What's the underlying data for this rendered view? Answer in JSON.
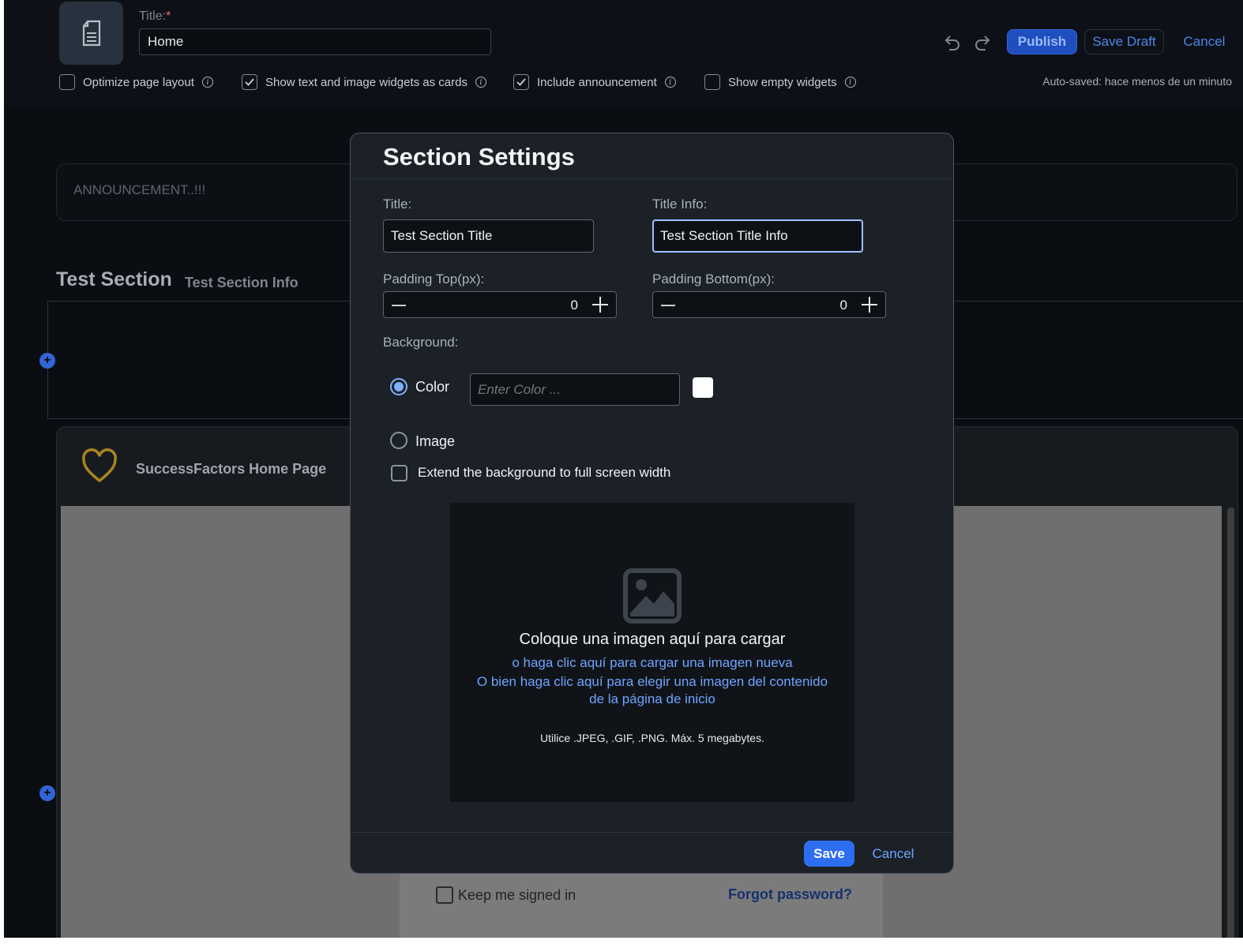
{
  "header": {
    "title_label": "Title:",
    "required_mark": "*",
    "title_value": "Home",
    "publish_label": "Publish",
    "save_draft_label": "Save Draft",
    "cancel_label": "Cancel",
    "options": [
      {
        "label": "Optimize page layout",
        "checked": false
      },
      {
        "label": "Show text and image widgets as cards",
        "checked": true
      },
      {
        "label": "Include announcement",
        "checked": true
      },
      {
        "label": "Show empty widgets",
        "checked": false
      }
    ],
    "autosave": "Auto-saved: hace menos de un minuto"
  },
  "page": {
    "announcement": "ANNOUNCEMENT..!!!",
    "section_title": "Test Section",
    "section_info": "Test Section Info",
    "widget_title": "SuccessFactors Home Page",
    "keep_signed_in": "Keep me signed in",
    "forgot_password": "Forgot password?"
  },
  "modal": {
    "title": "Section Settings",
    "title_label": "Title:",
    "title_value": "Test Section Title",
    "title_info_label": "Title Info:",
    "title_info_value": "Test Section Title Info",
    "padding_top_label": "Padding Top(px):",
    "padding_top_value": "0",
    "padding_bottom_label": "Padding Bottom(px):",
    "padding_bottom_value": "0",
    "background_label": "Background:",
    "color_option": "Color",
    "color_placeholder": "Enter Color ...",
    "color_swatch": "#ffffff",
    "image_option": "Image",
    "extend_label": "Extend the background to full screen width",
    "dropzone": {
      "main": "Coloque una imagen aquí para cargar",
      "link1": "o haga clic aquí para cargar una imagen nueva",
      "link2_line1": "O bien haga clic aquí para elegir una imagen del contenido",
      "link2_line2": "de la página de inicio",
      "note": "Utilice .JPEG, .GIF, .PNG. Máx. 5 megabytes."
    },
    "save_label": "Save",
    "cancel_label": "Cancel"
  },
  "colors": {
    "accent": "#2d6ef0",
    "link": "#6ea4ff",
    "background": "#0a0d11"
  }
}
